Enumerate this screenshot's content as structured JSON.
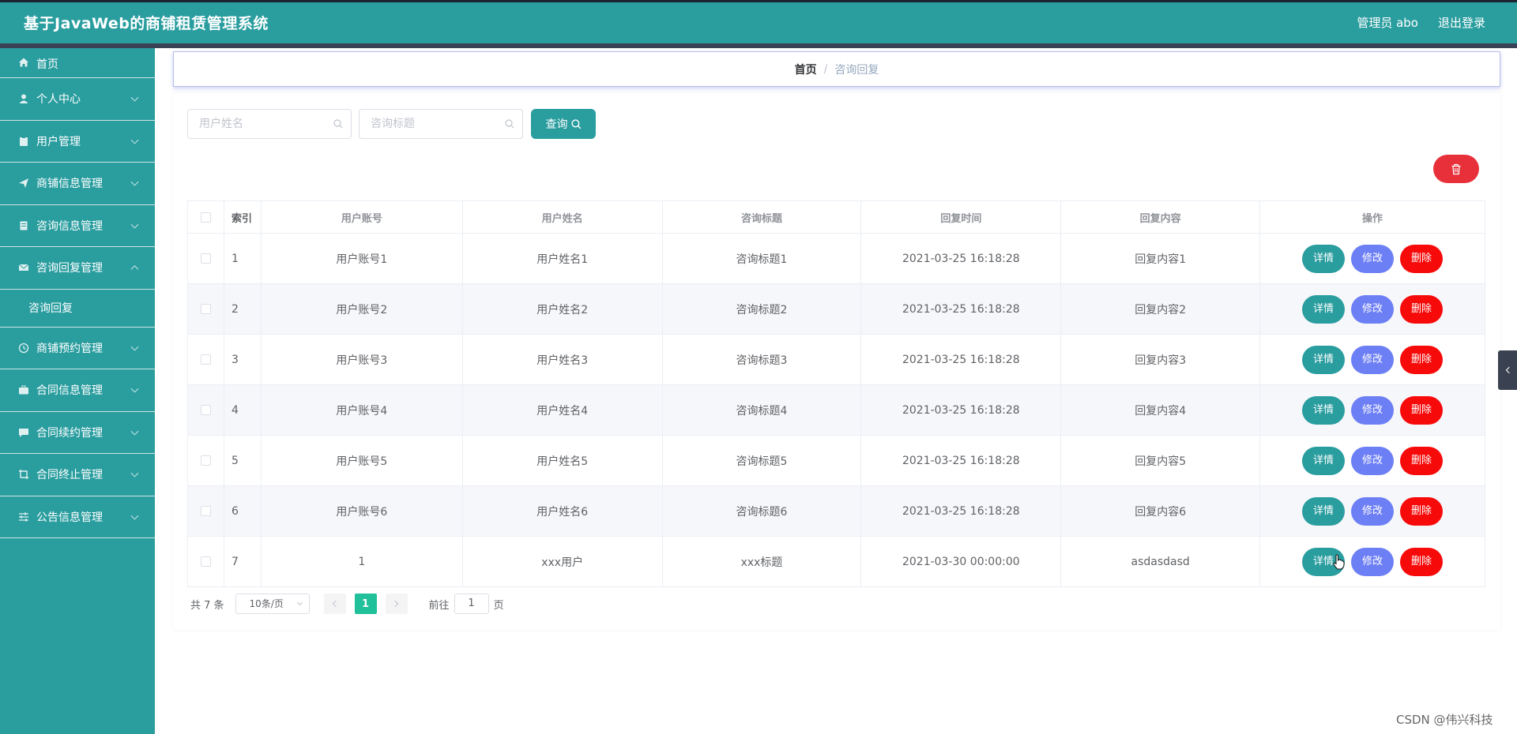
{
  "header": {
    "title": "基于JavaWeb的商铺租赁管理系统",
    "user": "管理员 abo",
    "logout": "退出登录"
  },
  "sidebar": {
    "items": [
      {
        "label": "首页",
        "icon": "home-icon"
      },
      {
        "label": "个人中心",
        "icon": "user-icon"
      },
      {
        "label": "用户管理",
        "icon": "clipboard-icon"
      },
      {
        "label": "商铺信息管理",
        "icon": "send-icon"
      },
      {
        "label": "咨询信息管理",
        "icon": "document-icon"
      },
      {
        "label": "咨询回复管理",
        "icon": "message-icon"
      },
      {
        "label": "商铺预约管理",
        "icon": "clock-icon"
      },
      {
        "label": "合同信息管理",
        "icon": "suitcase-icon"
      },
      {
        "label": "合同续约管理",
        "icon": "chat-icon"
      },
      {
        "label": "合同终止管理",
        "icon": "crop-icon"
      },
      {
        "label": "公告信息管理",
        "icon": "sliders-icon"
      }
    ],
    "sub_item": "咨询回复"
  },
  "breadcrumb": {
    "home": "首页",
    "separator": "/",
    "current": "咨询回复"
  },
  "search": {
    "name_placeholder": "用户姓名",
    "title_placeholder": "咨询标题",
    "query_label": "查询"
  },
  "table": {
    "headers": [
      "索引",
      "用户账号",
      "用户姓名",
      "咨询标题",
      "回复时间",
      "回复内容",
      "操作"
    ],
    "rows": [
      {
        "index": "1",
        "account": "用户账号1",
        "name": "用户姓名1",
        "title": "咨询标题1",
        "time": "2021-03-25 16:18:28",
        "content": "回复内容1"
      },
      {
        "index": "2",
        "account": "用户账号2",
        "name": "用户姓名2",
        "title": "咨询标题2",
        "time": "2021-03-25 16:18:28",
        "content": "回复内容2"
      },
      {
        "index": "3",
        "account": "用户账号3",
        "name": "用户姓名3",
        "title": "咨询标题3",
        "time": "2021-03-25 16:18:28",
        "content": "回复内容3"
      },
      {
        "index": "4",
        "account": "用户账号4",
        "name": "用户姓名4",
        "title": "咨询标题4",
        "time": "2021-03-25 16:18:28",
        "content": "回复内容4"
      },
      {
        "index": "5",
        "account": "用户账号5",
        "name": "用户姓名5",
        "title": "咨询标题5",
        "time": "2021-03-25 16:18:28",
        "content": "回复内容5"
      },
      {
        "index": "6",
        "account": "用户账号6",
        "name": "用户姓名6",
        "title": "咨询标题6",
        "time": "2021-03-25 16:18:28",
        "content": "回复内容6"
      },
      {
        "index": "7",
        "account": "1",
        "name": "xxx用户",
        "title": "xxx标题",
        "time": "2021-03-30 00:00:00",
        "content": "asdasdasd"
      }
    ],
    "actions": {
      "detail": "详情",
      "edit": "修改",
      "delete": "删除"
    }
  },
  "pagination": {
    "total": "共 7 条",
    "page_size": "10条/页",
    "current_page": "1",
    "goto_prefix": "前往",
    "goto_value": "1",
    "goto_suffix": "页"
  },
  "watermark": "CSDN @伟兴科技",
  "colors": {
    "primary": "#2a9d9f",
    "edit": "#6d7ff5",
    "danger": "#f70a0a",
    "page_active": "#20c09a"
  }
}
